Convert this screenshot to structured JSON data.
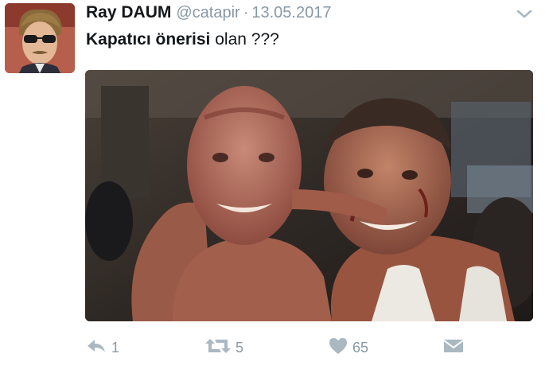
{
  "tweet": {
    "display_name": "Ray DAUM",
    "handle": "@catapir",
    "separator": "·",
    "date": "13.05.2017",
    "text_bold": "Kapatıcı önerisi",
    "text_rest": " olan ???"
  },
  "actions": {
    "reply_count": "1",
    "retweet_count": "5",
    "like_count": "65"
  },
  "colors": {
    "meta_gray": "#8899a6",
    "icon_gray": "#aab8c2"
  },
  "icons": [
    "chevron-down-icon",
    "reply-icon",
    "retweet-icon",
    "heart-icon",
    "envelope-icon"
  ]
}
